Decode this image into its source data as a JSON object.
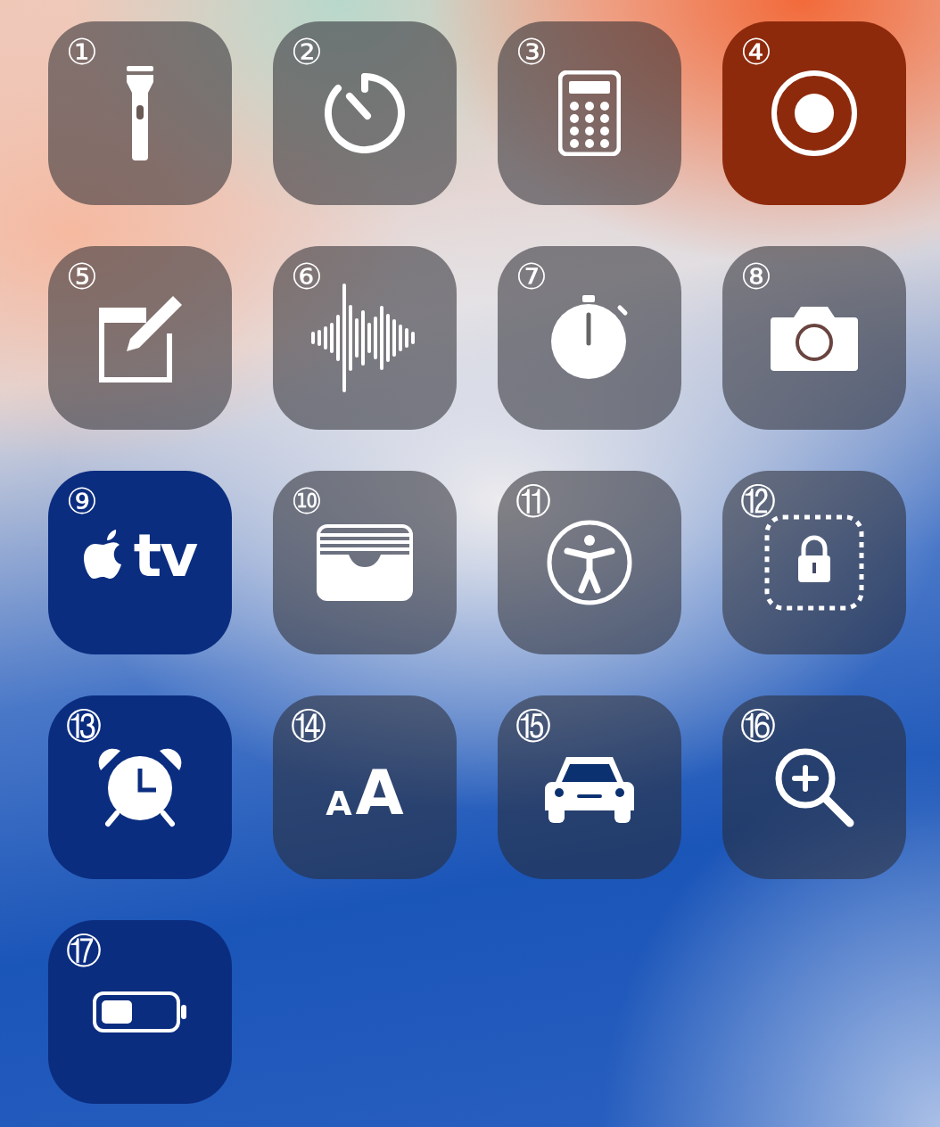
{
  "tiles": [
    {
      "number": "①",
      "kind": "flashlight"
    },
    {
      "number": "②",
      "kind": "timer"
    },
    {
      "number": "③",
      "kind": "calculator"
    },
    {
      "number": "④",
      "kind": "record",
      "color": "#8e2a0c"
    },
    {
      "number": "⑤",
      "kind": "notes"
    },
    {
      "number": "⑥",
      "kind": "waveform"
    },
    {
      "number": "⑦",
      "kind": "stopwatch"
    },
    {
      "number": "⑧",
      "kind": "camera"
    },
    {
      "number": "⑨",
      "kind": "tv",
      "label": "tv",
      "color": "#0b2d80"
    },
    {
      "number": "⑩",
      "kind": "wallet"
    },
    {
      "number": "⑪",
      "kind": "accessibility"
    },
    {
      "number": "⑫",
      "kind": "guided-access"
    },
    {
      "number": "⑬",
      "kind": "alarm",
      "color": "#0b2d80"
    },
    {
      "number": "⑭",
      "kind": "text-size",
      "small_letter": "A",
      "large_letter": "A"
    },
    {
      "number": "⑮",
      "kind": "car"
    },
    {
      "number": "⑯",
      "kind": "magnifier"
    },
    {
      "number": "⑰",
      "kind": "battery",
      "color": "#0b2d80"
    }
  ]
}
